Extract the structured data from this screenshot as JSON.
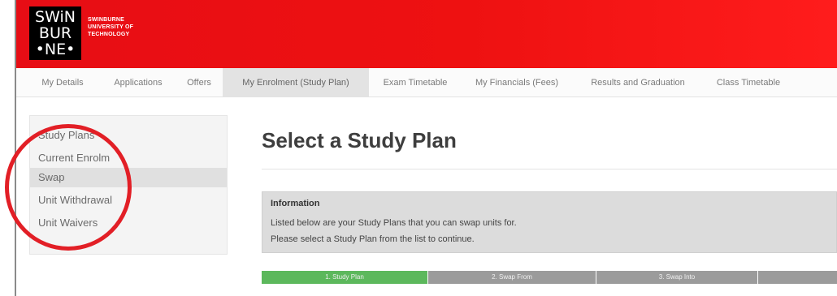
{
  "header": {
    "logo_lines": [
      "SWiN",
      "BUR",
      "•NE•"
    ],
    "university_name": [
      "SWINBURNE",
      "UNIVERSITY OF",
      "TECHNOLOGY"
    ]
  },
  "nav": {
    "tabs": [
      {
        "label": "My Details"
      },
      {
        "label": "Applications"
      },
      {
        "label": "Offers"
      },
      {
        "label": "My Enrolment (Study Plan)",
        "active": true
      },
      {
        "label": "Exam Timetable"
      },
      {
        "label": "My Financials (Fees)"
      },
      {
        "label": "Results and Graduation"
      },
      {
        "label": "Class Timetable"
      }
    ]
  },
  "sidebar": {
    "items": [
      {
        "label": "Study Plans"
      },
      {
        "label": "Current Enrolm"
      },
      {
        "label": "Swap",
        "active": true
      },
      {
        "label": "Unit Withdrawal"
      },
      {
        "label": "Unit Waivers"
      }
    ],
    "highlight_color": "#e21f26"
  },
  "main": {
    "title": "Select a Study Plan",
    "info": {
      "heading": "Information",
      "lines": [
        "Listed below are your Study Plans that you can swap units for.",
        "Please select a Study Plan from the list to continue."
      ]
    },
    "steps": [
      {
        "label": "1. Study Plan",
        "active": true
      },
      {
        "label": "2. Swap From"
      },
      {
        "label": "3. Swap Into"
      },
      {
        "label": ""
      }
    ]
  },
  "colors": {
    "brand_red": "#e70d15",
    "step_active": "#5cb85c",
    "step_inactive": "#9b9b9b"
  }
}
